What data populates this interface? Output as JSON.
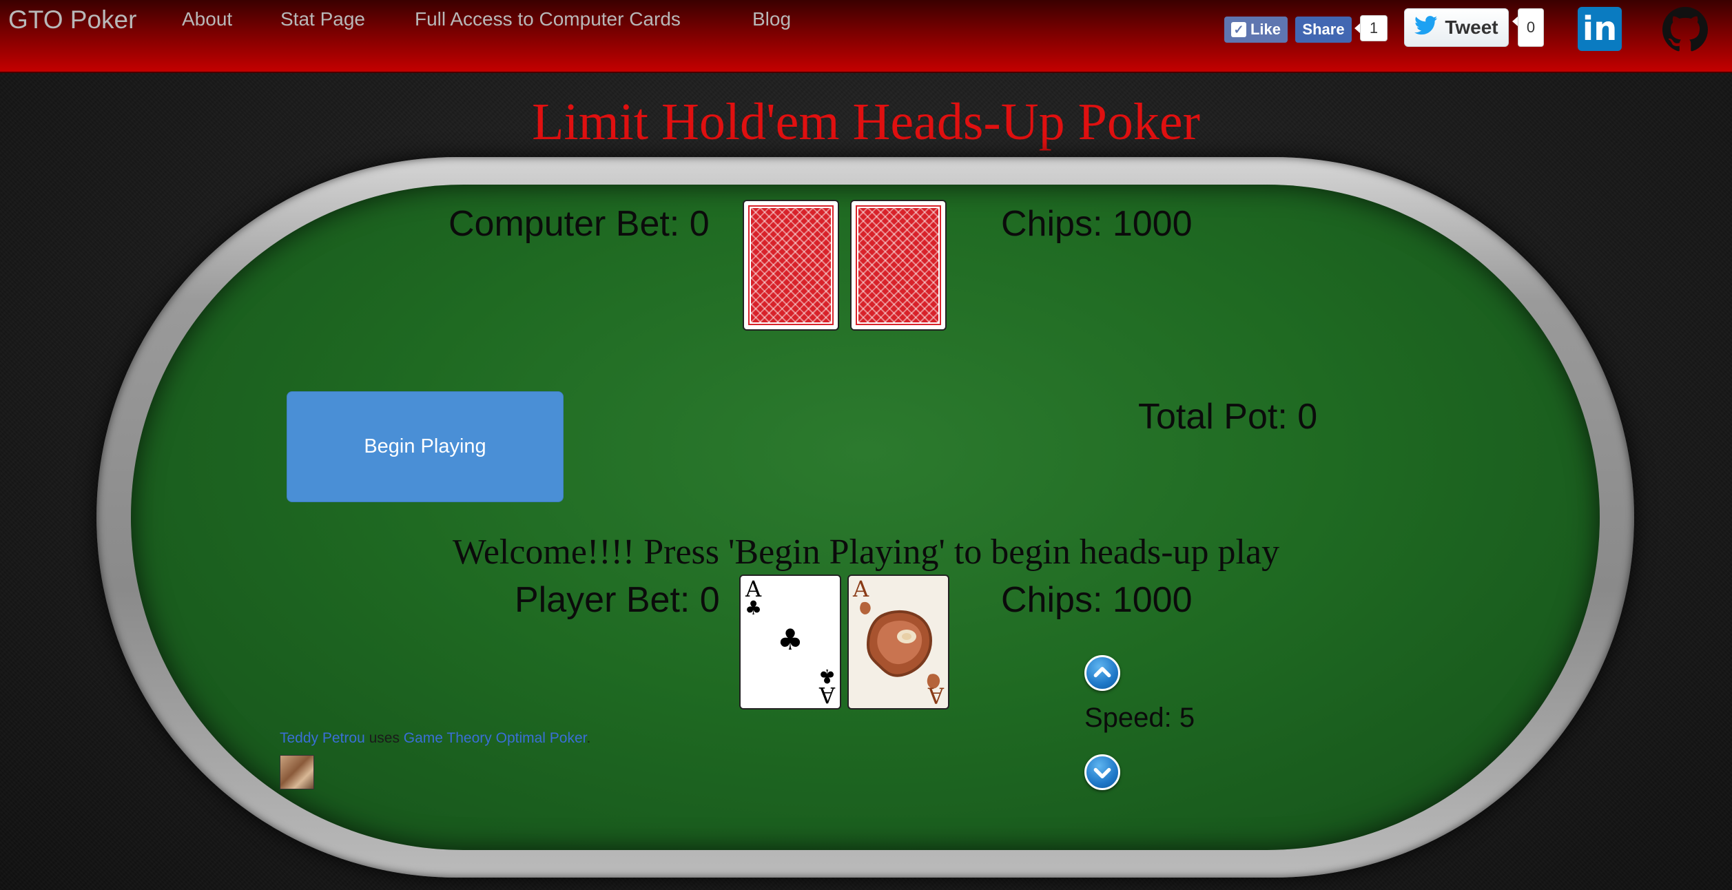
{
  "navbar": {
    "brand": "GTO Poker",
    "links": [
      "About",
      "Stat Page",
      "Full Access to Computer Cards",
      "Blog"
    ],
    "fb_like": "Like",
    "fb_share": "Share",
    "fb_count": "1",
    "tweet": "Tweet",
    "tweet_count": "0",
    "linkedin": "in"
  },
  "title": "Limit Hold'em Heads-Up Poker",
  "computer": {
    "bet_label": "Computer Bet: 0",
    "chips_label": "Chips: 1000"
  },
  "pot_label": "Total Pot: 0",
  "begin_button": "Begin Playing",
  "welcome_message": "Welcome!!!! Press 'Begin Playing' to begin heads-up play",
  "player": {
    "bet_label": "Player Bet: 0",
    "chips_label": "Chips: 1000",
    "cards": [
      {
        "rank": "A",
        "suit": "♣"
      },
      {
        "rank": "A",
        "suit": "steak"
      }
    ]
  },
  "speed_label": "Speed: 5",
  "credit": {
    "name": "Teddy Petrou",
    "middle": " uses ",
    "link": "Game Theory Optimal Poker",
    "end": "."
  },
  "colors": {
    "title": "#e01010",
    "navbar": "#b00000",
    "felt": "#1f6a22",
    "button": "#4a8fd6"
  }
}
